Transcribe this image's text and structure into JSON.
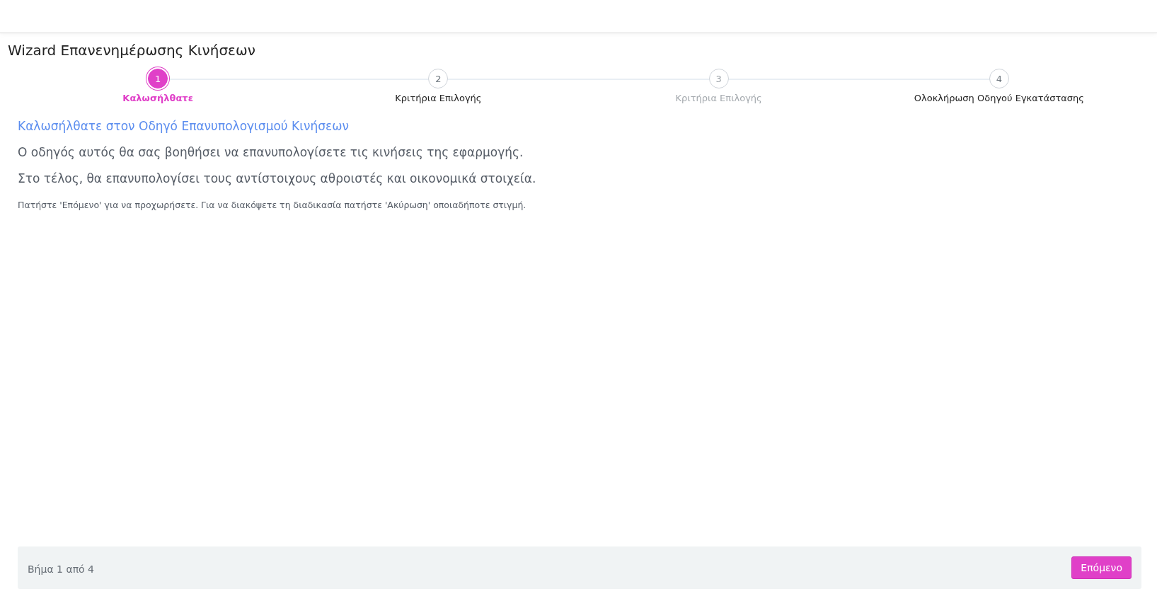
{
  "title": "Wizard Επανενημέρωσης Κινήσεων",
  "steps": [
    {
      "number": "1",
      "label": "Καλωσήλθατε",
      "selected": true,
      "disabled": false
    },
    {
      "number": "2",
      "label": "Κριτήρια Επιλογής",
      "selected": false,
      "disabled": false
    },
    {
      "number": "3",
      "label": "Κριτήρια Επιλογής",
      "selected": false,
      "disabled": true
    },
    {
      "number": "4",
      "label": "Ολοκλήρωση Οδηγού Εγκατάστασης",
      "selected": false,
      "disabled": false
    }
  ],
  "content": {
    "heading": "Καλωσήλθατε στον Οδηγό Επανυπολογισμού Κινήσεων",
    "paragraphs": [
      "Ο οδηγός αυτός θα σας βοηθήσει να επανυπολογίσετε τις κινήσεις της εφαρμογής.",
      "Στο τέλος, θα επανυπολογίσει τους αντίστοιχους αθροιστές και οικονομικά στοιχεία."
    ],
    "hint": "Πατήστε 'Επόμενο' για να προχωρήσετε. Για να διακόψετε τη διαδικασία πατήστε 'Ακύρωση' οποιαδήποτε στιγμή."
  },
  "footer": {
    "step_text": "Βήμα 1 από 4",
    "next_button": "Επόμενο"
  }
}
